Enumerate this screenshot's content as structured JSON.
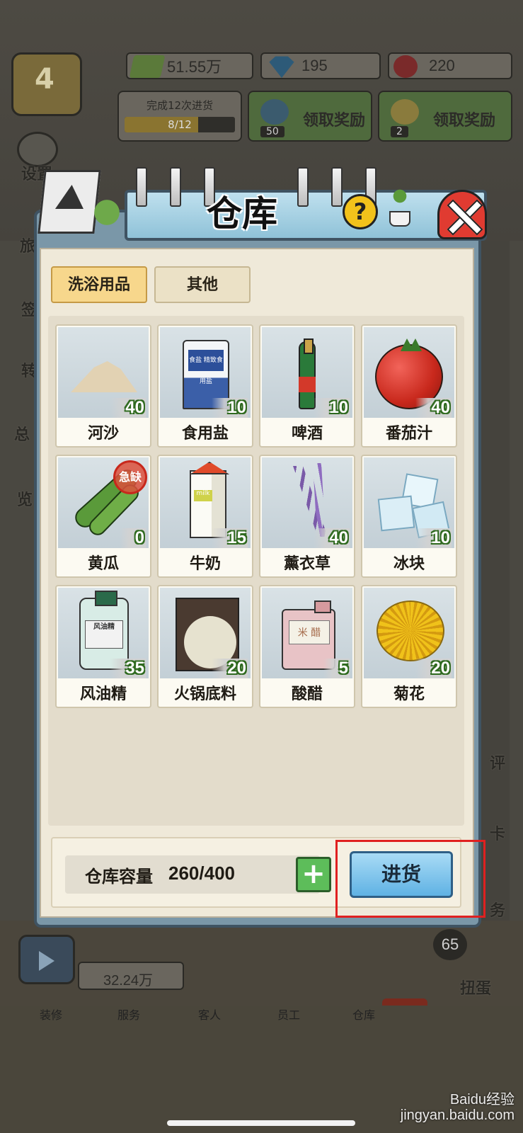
{
  "hud": {
    "level": "4",
    "money": "51.55万",
    "gems": "195",
    "roses": "220",
    "task": {
      "text": "完成12次进货",
      "progress": "8/12",
      "progress_fraction": 0.667
    },
    "rewards": [
      {
        "label": "领取奖励",
        "count": "50",
        "icon": "gem-icon"
      },
      {
        "label": "领取奖励",
        "count": "2",
        "icon": "flower-icon"
      }
    ],
    "settings_label": "设置",
    "income": "32.24万",
    "egg_count": "65",
    "urgent_tag": "急"
  },
  "side_labels": [
    "旅",
    "签",
    "转",
    "总",
    "览",
    "评",
    "卡",
    "务",
    "扭蛋"
  ],
  "bottom_nav": [
    "装修",
    "服务",
    "客人",
    "员工",
    "仓库"
  ],
  "modal": {
    "title": "仓库",
    "help": "?",
    "tabs": [
      {
        "label": "洗浴用品",
        "active": true
      },
      {
        "label": "其他",
        "active": false
      }
    ],
    "items": [
      {
        "name": "河沙",
        "qty": "40",
        "icon": "sand-icon"
      },
      {
        "name": "食用盐",
        "qty": "10",
        "icon": "salt-icon",
        "label": "食盐\n精致食用盐"
      },
      {
        "name": "啤酒",
        "qty": "10",
        "icon": "beer-icon"
      },
      {
        "name": "番茄汁",
        "qty": "40",
        "icon": "tomato-icon"
      },
      {
        "name": "黄瓜",
        "qty": "0",
        "icon": "cucumber-icon",
        "stamp": "急缺"
      },
      {
        "name": "牛奶",
        "qty": "15",
        "icon": "milk-icon",
        "label": "milk"
      },
      {
        "name": "薰衣草",
        "qty": "40",
        "icon": "lavender-icon"
      },
      {
        "name": "冰块",
        "qty": "10",
        "icon": "ice-icon"
      },
      {
        "name": "风油精",
        "qty": "35",
        "icon": "oil-bottle-icon",
        "label": "风油精"
      },
      {
        "name": "火锅底料",
        "qty": "20",
        "icon": "hotpot-base-icon"
      },
      {
        "name": "酸醋",
        "qty": "5",
        "icon": "vinegar-icon",
        "label": "米 醋"
      },
      {
        "name": "菊花",
        "qty": "20",
        "icon": "chrysanthemum-icon"
      }
    ],
    "capacity_label": "仓库容量",
    "capacity_value": "260/400",
    "plus": "+",
    "restock_label": "进货"
  },
  "watermark": "Baidu经验\njingyan.baidu.com",
  "colors": {
    "accent_green": "#5dbd5a",
    "accent_blue": "#5fb2e4",
    "highlight_red": "#e02020",
    "qty_green": "#2f6a1f"
  }
}
